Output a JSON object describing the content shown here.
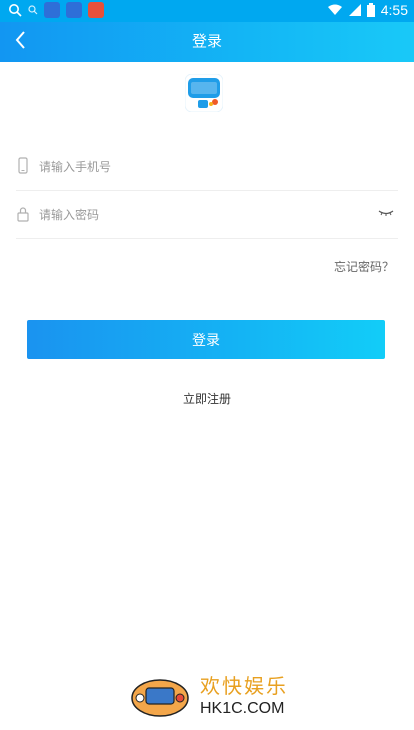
{
  "status_bar": {
    "time": "4:55",
    "battery_badge": "4",
    "icons": [
      "search-icon",
      "search-small-icon",
      "baidu-app-icon",
      "baidu-app-icon",
      "app-icon",
      "wifi-icon",
      "signal-icon",
      "battery-icon"
    ]
  },
  "header": {
    "title": "登录"
  },
  "login_form": {
    "phone_placeholder": "请输入手机号",
    "password_placeholder": "请输入密码",
    "forgot_password": "忘记密码？",
    "login_button": "登录",
    "register_link": "立即注册"
  },
  "watermark": {
    "chinese": "欢快娱乐",
    "site": "HK1C.COM"
  },
  "colors": {
    "accent": "#13b6f5",
    "status_bar": "#00a8f0"
  }
}
